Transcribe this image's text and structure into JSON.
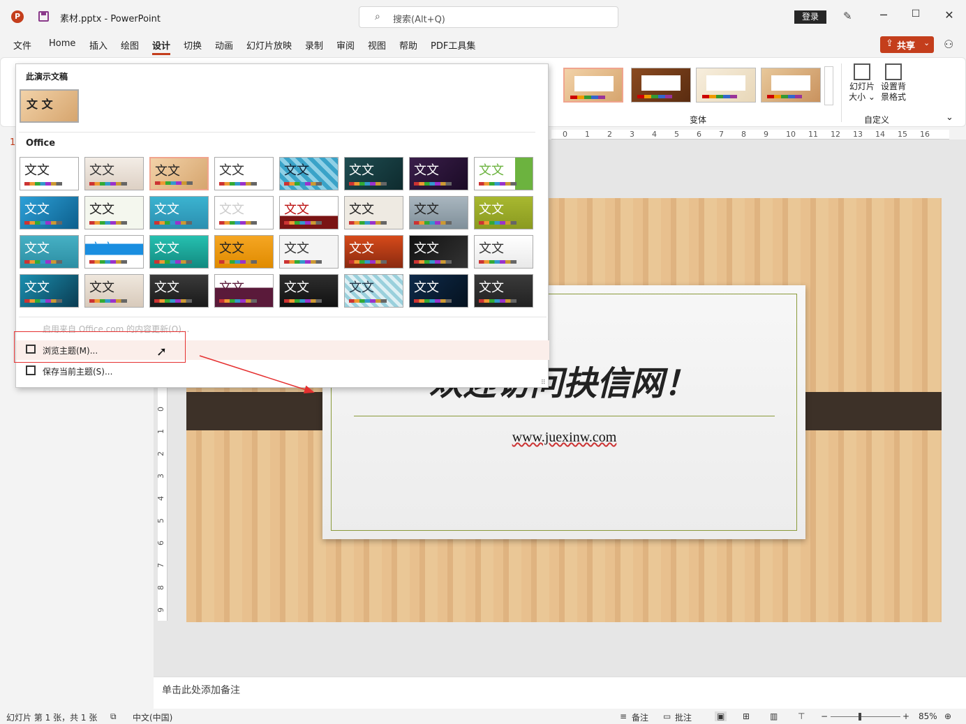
{
  "titlebar": {
    "app_letter": "P",
    "doc_title": "素材.pptx  -  PowerPoint",
    "search_placeholder": "搜索(Alt+Q)",
    "login_label": "登录",
    "minimize": "─",
    "maximize": "☐",
    "close": "✕"
  },
  "menu": {
    "items": [
      "文件",
      "Home",
      "插入",
      "绘图",
      "设计",
      "切换",
      "动画",
      "幻灯片放映",
      "录制",
      "审阅",
      "视图",
      "帮助",
      "PDF工具集"
    ],
    "active": "设计",
    "share_label": "共享"
  },
  "ribbon": {
    "variants_label": "变体",
    "slide_size": "幻灯片大小",
    "slide_size_line1": "幻灯片",
    "slide_size_line2": "大小 ⌄",
    "format_bg_line1": "设置背",
    "format_bg_line2": "景格式",
    "custom_label": "自定义"
  },
  "ruler": {
    "h_ticks": [
      "0",
      "1",
      "2",
      "3",
      "4",
      "5",
      "6",
      "7",
      "8",
      "9",
      "10",
      "11",
      "12",
      "13",
      "14",
      "15",
      "16"
    ],
    "v_ticks": [
      "0",
      "1",
      "2",
      "3",
      "4",
      "5",
      "6",
      "7",
      "8",
      "9"
    ]
  },
  "dropdown": {
    "section_current": "此演示文稿",
    "current_theme_text": "文 文",
    "section_office": "Office",
    "theme_text": "文文",
    "update_label": "启用来自 Office.com 的内容更新(O)...",
    "browse_label": "浏览主题(M)...",
    "save_label": "保存当前主题(S)..."
  },
  "slide": {
    "title": "欢迎访问抉信网！",
    "url": "www.juexinw.com",
    "thumb_number": "1"
  },
  "notes": {
    "placeholder": "单击此处添加备注"
  },
  "status": {
    "slide_info": "幻灯片 第 1 张，共 1 张",
    "language": "中文(中国)",
    "notes_btn": "备注",
    "comments_btn": "批注",
    "zoom": "85%"
  },
  "colors": {
    "accent": "#c43e1c",
    "highlight_box": "#e53030",
    "wood": "#e8c08e",
    "strap": "#3d3128"
  }
}
